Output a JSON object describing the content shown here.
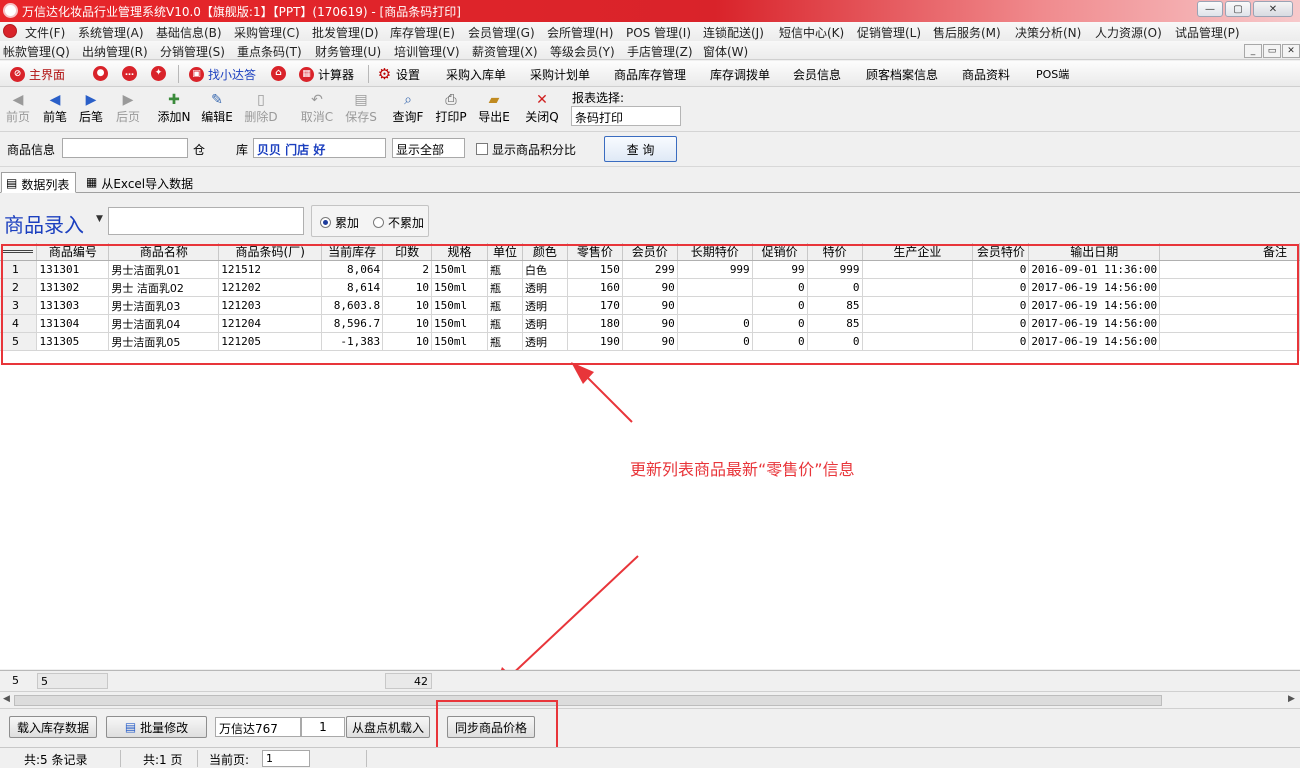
{
  "window": {
    "title": "万信达化妆品行业管理系统V10.0【旗舰版:1】【PPT】(170619) - [商品条码打印]",
    "controls": [
      "—",
      "▢",
      "✕"
    ]
  },
  "menu_row1": [
    "文件(F)",
    "系统管理(A)",
    "基础信息(B)",
    "采购管理(C)",
    "批发管理(D)",
    "库存管理(E)",
    "会员管理(G)",
    "会所管理(H)",
    "POS 管理(I)",
    "连锁配送(J)",
    "短信中心(K)",
    "促销管理(L)",
    "售后服务(M)",
    "决策分析(N)",
    "人力资源(O)",
    "试品管理(P)"
  ],
  "menu_row2": [
    "帐款管理(Q)",
    "出纳管理(R)",
    "分销管理(S)",
    "重点条码(T)",
    "财务管理(U)",
    "培训管理(V)",
    "薪资管理(X)",
    "等级会员(Y)",
    "手店管理(Z)",
    "窗体(W)"
  ],
  "quickbar": {
    "home": "主界面",
    "find_help": "找小达答",
    "calculator": "计算器",
    "settings": "设置",
    "links": [
      "采购入库单",
      "采购计划单",
      "商品库存管理",
      "库存调拨单",
      "会员信息",
      "顾客档案信息",
      "商品资料",
      "POS端"
    ]
  },
  "toolbar": {
    "first": "前页",
    "prev": "前笔",
    "next": "后笔",
    "last": "后页",
    "add": "添加N",
    "edit": "编辑E",
    "delete": "删除D",
    "cancel": "取消C",
    "save": "保存S",
    "query": "查询F",
    "print": "打印P",
    "export": "导出E",
    "close": "关闭Q",
    "report_label": "报表选择:",
    "report_value": "条码打印"
  },
  "filters": {
    "product_info_label": "商品信息",
    "warehouse_label_1": "仓",
    "warehouse_label_2": "库",
    "warehouse_value": "贝贝 门店 好",
    "show_all": "显示全部",
    "show_points_label": "显示商品积分比",
    "query_button": "查 询"
  },
  "tabs": [
    "数据列表",
    "从Excel导入数据"
  ],
  "entry": {
    "title": "商品录入",
    "radio_accumulate": "累加",
    "radio_no_accumulate": "不累加"
  },
  "grid": {
    "columns": [
      "商品编号",
      "商品名称",
      "商品条码(厂)",
      "当前库存",
      "印数",
      "规格",
      "单位",
      "颜色",
      "零售价",
      "会员价",
      "长期特价",
      "促销价",
      "特价",
      "生产企业",
      "会员特价",
      "输出日期",
      "备注"
    ],
    "rows": [
      [
        "1",
        "131301",
        "男士洁面乳01",
        "121512",
        "8,064",
        "2",
        "150ml",
        "瓶",
        "白色",
        "150",
        "299",
        "999",
        "99",
        "999",
        "",
        "0",
        "2016-09-01 11:36:00",
        ""
      ],
      [
        "2",
        "131302",
        "男士 洁面乳02",
        "121202",
        "8,614",
        "10",
        "150ml",
        "瓶",
        "透明",
        "160",
        "90",
        "",
        "0",
        "0",
        "",
        "0",
        "2017-06-19 14:56:00",
        ""
      ],
      [
        "3",
        "131303",
        "男士洁面乳03",
        "121203",
        "8,603.8",
        "10",
        "150ml",
        "瓶",
        "透明",
        "170",
        "90",
        "",
        "0",
        "85",
        "",
        "0",
        "2017-06-19 14:56:00",
        ""
      ],
      [
        "4",
        "131304",
        "男士洁面乳04",
        "121204",
        "8,596.7",
        "10",
        "150ml",
        "瓶",
        "透明",
        "180",
        "90",
        "0",
        "0",
        "85",
        "",
        "0",
        "2017-06-19 14:56:00",
        ""
      ],
      [
        "5",
        "131305",
        "男士洁面乳05",
        "121205",
        "-1,383",
        "10",
        "150ml",
        "瓶",
        "透明",
        "190",
        "90",
        "0",
        "0",
        "0",
        "",
        "0",
        "2017-06-19 14:56:00",
        ""
      ]
    ],
    "summary": {
      "row_count": "5",
      "count": "5",
      "print_total": "42"
    }
  },
  "annotation": "更新列表商品最新“零售价”信息",
  "bottom": {
    "load_stock": "载入库存数据",
    "batch_edit": "批量修改",
    "device_name": "万信达767",
    "device_qty": "1",
    "load_from_device": "从盘点机载入",
    "sync_price": "同步商品价格"
  },
  "status": {
    "records": "共:5 条记录",
    "pages": "共:1 页",
    "current_page_label": "当前页:",
    "current_page": "1"
  },
  "colors": {
    "brand_red": "#d9232a",
    "annotation_red": "#e8353a",
    "link_blue": "#1b3fbf"
  }
}
